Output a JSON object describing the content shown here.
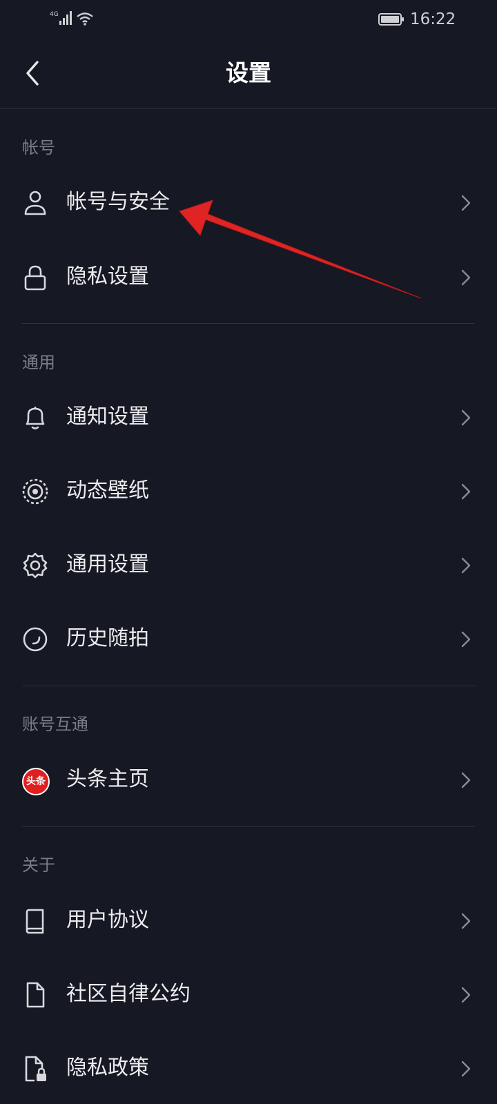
{
  "status_bar": {
    "network": "4G",
    "time": "16:22"
  },
  "header": {
    "title": "设置"
  },
  "sections": {
    "account": {
      "title": "帐号",
      "items": [
        {
          "label": "帐号与安全",
          "icon": "user-icon"
        },
        {
          "label": "隐私设置",
          "icon": "lock-icon"
        }
      ]
    },
    "general": {
      "title": "通用",
      "items": [
        {
          "label": "通知设置",
          "icon": "bell-icon"
        },
        {
          "label": "动态壁纸",
          "icon": "live-wallpaper-icon"
        },
        {
          "label": "通用设置",
          "icon": "gear-icon"
        },
        {
          "label": "历史随拍",
          "icon": "history-icon"
        }
      ]
    },
    "linked": {
      "title": "账号互通",
      "items": [
        {
          "label": "头条主页",
          "icon": "toutiao-logo-icon",
          "logo_text": "头条"
        }
      ]
    },
    "about": {
      "title": "关于",
      "items": [
        {
          "label": "用户协议",
          "icon": "book-icon"
        },
        {
          "label": "社区自律公约",
          "icon": "document-icon"
        },
        {
          "label": "隐私政策",
          "icon": "privacy-document-icon"
        }
      ]
    }
  },
  "colors": {
    "background": "#161823",
    "annotation_arrow": "#e02424",
    "toutiao_logo": "#e02020"
  }
}
